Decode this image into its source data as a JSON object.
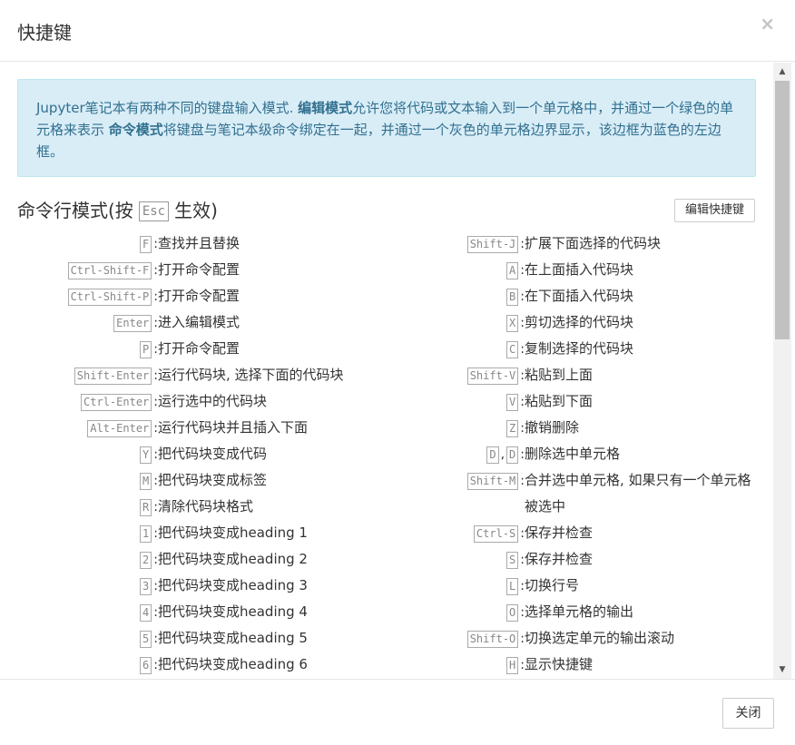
{
  "dialog": {
    "title": "快捷键",
    "close_symbol": "×",
    "close_button_label": "关闭"
  },
  "info": {
    "text_a": "Jupyter笔记本有两种不同的键盘输入模式. ",
    "bold_a": "编辑模式",
    "text_b": "允许您将代码或文本输入到一个单元格中，并通过一个绿色的单元格来表示 ",
    "bold_b": "命令模式",
    "text_c": "将键盘与笔记本级命令绑定在一起，并通过一个灰色的单元格边界显示，该边框为蓝色的左边框。"
  },
  "section": {
    "title_prefix": "命令行模式(按",
    "esc_key": "Esc",
    "title_suffix": "生效)",
    "edit_shortcuts_label": "编辑快捷键"
  },
  "left_shortcuts": [
    {
      "keys": [
        "F"
      ],
      "desc": "查找并且替换"
    },
    {
      "keys": [
        "Ctrl-Shift-F"
      ],
      "desc": "打开命令配置"
    },
    {
      "keys": [
        "Ctrl-Shift-P"
      ],
      "desc": "打开命令配置"
    },
    {
      "keys": [
        "Enter"
      ],
      "desc": "进入编辑模式"
    },
    {
      "keys": [
        "P"
      ],
      "desc": "打开命令配置"
    },
    {
      "keys": [
        "Shift-Enter"
      ],
      "desc": "运行代码块, 选择下面的代码块"
    },
    {
      "keys": [
        "Ctrl-Enter"
      ],
      "desc": "运行选中的代码块"
    },
    {
      "keys": [
        "Alt-Enter"
      ],
      "desc": "运行代码块并且插入下面"
    },
    {
      "keys": [
        "Y"
      ],
      "desc": "把代码块变成代码"
    },
    {
      "keys": [
        "M"
      ],
      "desc": "把代码块变成标签"
    },
    {
      "keys": [
        "R"
      ],
      "desc": "清除代码块格式"
    },
    {
      "keys": [
        "1"
      ],
      "desc": "把代码块变成heading 1"
    },
    {
      "keys": [
        "2"
      ],
      "desc": "把代码块变成heading 2"
    },
    {
      "keys": [
        "3"
      ],
      "desc": "把代码块变成heading 3"
    },
    {
      "keys": [
        "4"
      ],
      "desc": "把代码块变成heading 4"
    },
    {
      "keys": [
        "5"
      ],
      "desc": "把代码块变成heading 5"
    },
    {
      "keys": [
        "6"
      ],
      "desc": "把代码块变成heading 6"
    }
  ],
  "right_shortcuts": [
    {
      "keys": [
        "Shift-J"
      ],
      "desc": "扩展下面选择的代码块"
    },
    {
      "keys": [
        "A"
      ],
      "desc": "在上面插入代码块"
    },
    {
      "keys": [
        "B"
      ],
      "desc": "在下面插入代码块"
    },
    {
      "keys": [
        "X"
      ],
      "desc": "剪切选择的代码块"
    },
    {
      "keys": [
        "C"
      ],
      "desc": "复制选择的代码块"
    },
    {
      "keys": [
        "Shift-V"
      ],
      "desc": "粘贴到上面"
    },
    {
      "keys": [
        "V"
      ],
      "desc": "粘贴到下面"
    },
    {
      "keys": [
        "Z"
      ],
      "desc": "撤销删除"
    },
    {
      "keys": [
        "D",
        "D"
      ],
      "desc": "删除选中单元格"
    },
    {
      "keys": [
        "Shift-M"
      ],
      "desc": "合并选中单元格, 如果只有一个单元格被选中"
    },
    {
      "keys": [
        "Ctrl-S"
      ],
      "desc": "保存并检查"
    },
    {
      "keys": [
        "S"
      ],
      "desc": "保存并检查"
    },
    {
      "keys": [
        "L"
      ],
      "desc": "切换行号"
    },
    {
      "keys": [
        "O"
      ],
      "desc": "选择单元格的输出"
    },
    {
      "keys": [
        "Shift-O"
      ],
      "desc": "切换选定单元的输出滚动"
    },
    {
      "keys": [
        "H"
      ],
      "desc": "显示快捷键"
    }
  ],
  "key_separator": ",",
  "scrollbar": {
    "up_icon": "▲",
    "down_icon": "▼",
    "position": 0.0
  }
}
